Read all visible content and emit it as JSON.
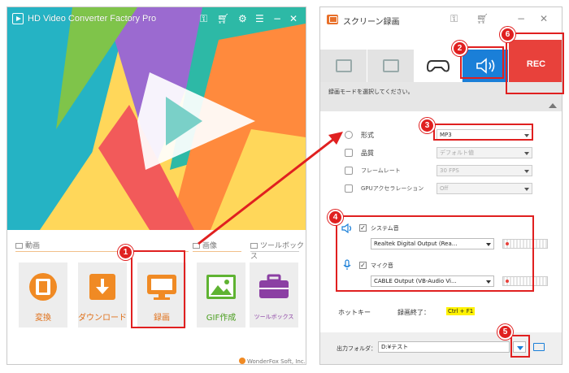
{
  "left_window": {
    "app_title": "HD Video Converter Factory Pro",
    "sections": {
      "video": "動画",
      "image": "画像",
      "toolbox": "ツールボックス"
    },
    "tiles": [
      {
        "label": "変換",
        "icon": "film-convert-icon"
      },
      {
        "label": "ダウンロード",
        "icon": "download-icon"
      },
      {
        "label": "録画",
        "icon": "screen-record-icon"
      },
      {
        "label": "GIF作成",
        "icon": "image-gif-icon"
      },
      {
        "label": "ツールボックス",
        "icon": "toolbox-icon"
      }
    ],
    "footer": "WonderFox Soft, Inc."
  },
  "right_window": {
    "title": "スクリーン録画",
    "rec_label": "REC",
    "hint": "録画モードを選択してください。",
    "settings": {
      "format_label": "形式",
      "format_value": "MP3",
      "quality_label": "品質",
      "quality_value": "デフォルト値",
      "framerate_label": "フレームレート",
      "framerate_value": "30 FPS",
      "gpu_label": "GPUアクセラレーション",
      "gpu_value": "Off"
    },
    "audio": {
      "system_label": "システム音",
      "system_device": "Realtek Digital Output (Rea...",
      "system_checked": true,
      "mic_label": "マイク音",
      "mic_device": "CABLE Output (VB-Audio Vi...",
      "mic_checked": true
    },
    "hotkey": {
      "label": "ホットキー",
      "end_label": "録画終了：",
      "keys": "Ctrl + F1"
    },
    "output": {
      "label": "出力フォルダ：",
      "path": "D:¥テスト"
    }
  },
  "annotations": {
    "badges": [
      "1",
      "2",
      "3",
      "4",
      "5",
      "6"
    ],
    "color": "#e02020"
  },
  "colors": {
    "rec_red": "#e8413b",
    "audio_blue": "#1a7fd8",
    "orange": "#f08a24"
  }
}
